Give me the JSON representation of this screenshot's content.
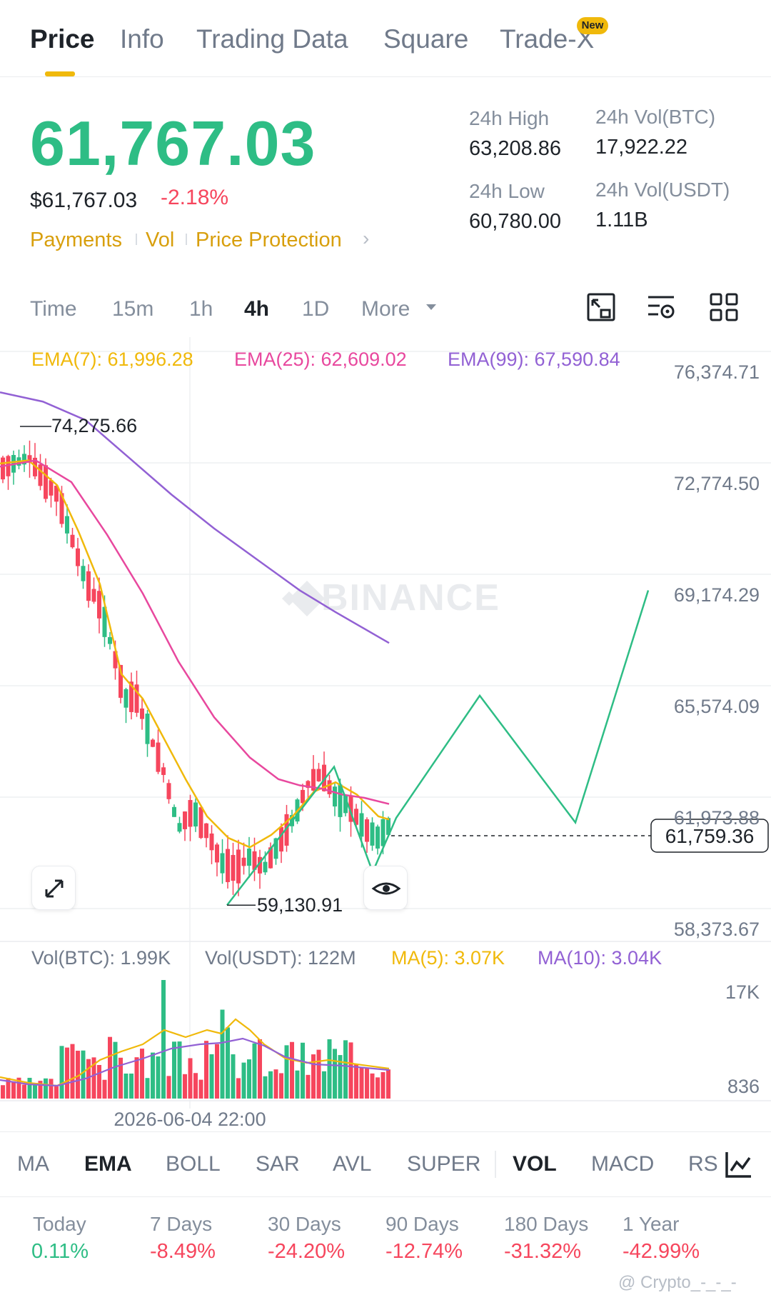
{
  "tabs": [
    {
      "label": "Price",
      "active": true
    },
    {
      "label": "Info",
      "active": false
    },
    {
      "label": "Trading Data",
      "active": false
    },
    {
      "label": "Square",
      "active": false
    },
    {
      "label": "Trade-X",
      "active": false,
      "badge": "New"
    }
  ],
  "price": {
    "last": "61,767.03",
    "usd": "$61,767.03",
    "change": "-2.18%",
    "links": [
      "Payments",
      "Vol",
      "Price Protection"
    ]
  },
  "stats": {
    "high_label": "24h High",
    "high": "63,208.86",
    "low_label": "24h Low",
    "low": "60,780.00",
    "vol_btc_label": "24h Vol(BTC)",
    "vol_btc": "17,922.22",
    "vol_usdt_label": "24h Vol(USDT)",
    "vol_usdt": "1.11B"
  },
  "timeframes": {
    "items": [
      "Time",
      "15m",
      "1h",
      "4h",
      "1D"
    ],
    "active": "4h",
    "more": "More"
  },
  "toolbar_icons": [
    "compare-icon",
    "chart-settings-icon",
    "grid-layout-icon"
  ],
  "indicators": {
    "ema7": "EMA(7): 61,996.28",
    "ema25": "EMA(25): 62,609.02",
    "ema99": "EMA(99): 67,590.84",
    "vol_btc": "Vol(BTC): 1.99K",
    "vol_usdt": "Vol(USDT): 122M",
    "ma5": "MA(5): 3.07K",
    "ma10": "MA(10): 3.04K"
  },
  "colors": {
    "up": "#2ebd85",
    "down": "#f6465d",
    "ema7": "#f0b90b",
    "ema25": "#e8489e",
    "ema99": "#9261d4",
    "accent": "#f0b90b"
  },
  "chart": {
    "y_axis": [
      "76,374.71",
      "72,774.50",
      "69,174.29",
      "65,574.09",
      "61,973.88",
      "58,373.67"
    ],
    "current_price_tag": "61,759.36",
    "max_label": "74,275.66",
    "min_label": "59,130.91",
    "watermark": "BINANCE",
    "vol_axis": [
      "17K",
      "836"
    ],
    "date_label": "2026-06-04 22:00"
  },
  "indicator_tabs": {
    "main": [
      "MA",
      "EMA",
      "BOLL",
      "SAR",
      "AVL",
      "SUPER"
    ],
    "sub": [
      "VOL",
      "MACD",
      "RSI"
    ],
    "main_active": "EMA",
    "sub_active": "VOL"
  },
  "performance": [
    {
      "label": "Today",
      "value": "0.11%",
      "positive": true
    },
    {
      "label": "7 Days",
      "value": "-8.49%",
      "positive": false
    },
    {
      "label": "30 Days",
      "value": "-24.20%",
      "positive": false
    },
    {
      "label": "90 Days",
      "value": "-12.74%",
      "positive": false
    },
    {
      "label": "180 Days",
      "value": "-31.32%",
      "positive": false
    },
    {
      "label": "1 Year",
      "value": "-42.99%",
      "positive": false
    }
  ],
  "watermark_credit": "@ Crypto_-_-_-"
}
